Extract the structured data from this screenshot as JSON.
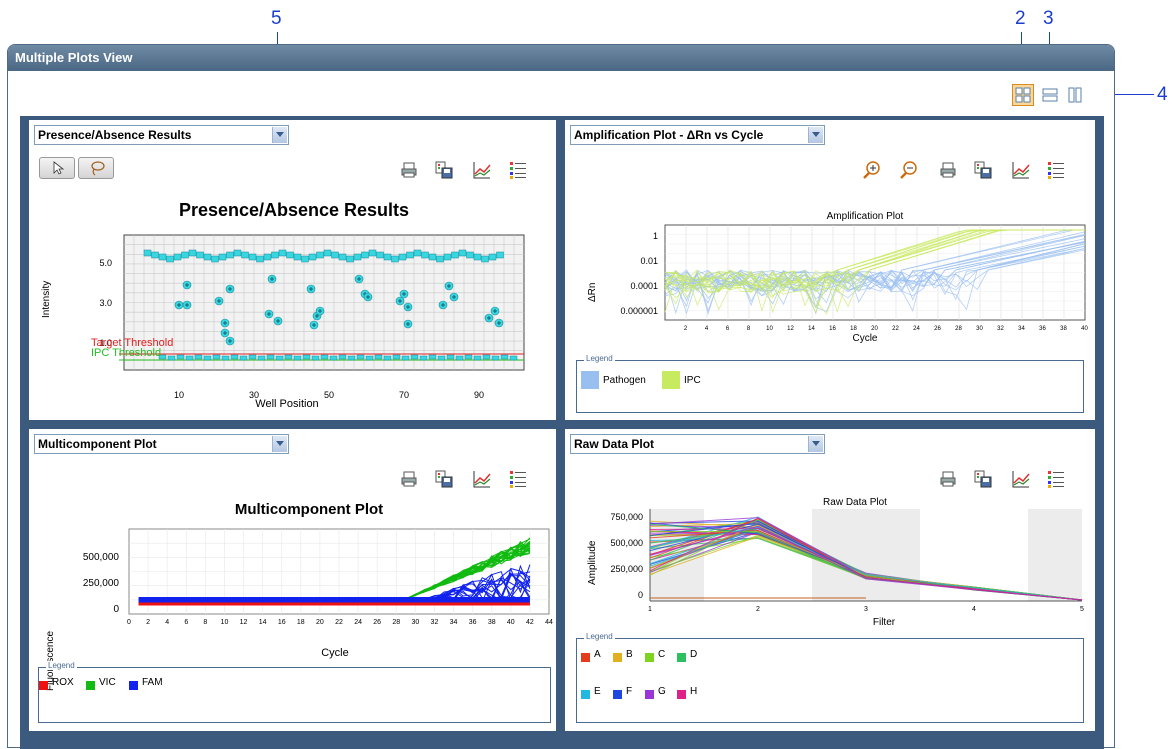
{
  "callouts": {
    "c5": "5",
    "c2": "2",
    "c3": "3",
    "c4": "4"
  },
  "window": {
    "title": "Multiple Plots View"
  },
  "layout_buttons": [
    "grid-2x2",
    "rows",
    "columns"
  ],
  "panels": {
    "pa": {
      "dropdown": "Presence/Absence Results",
      "tools": [
        "select-arrow-icon",
        "lasso-icon",
        "print-icon",
        "save-image-icon",
        "graph-properties-icon",
        "legend-icon"
      ],
      "chart_title": "Presence/Absence Results",
      "ylabel": "Intensity",
      "xlabel": "Well Position",
      "yticks": [
        "5.0",
        "3.0",
        "1.0"
      ],
      "xticks": [
        "10",
        "30",
        "50",
        "70",
        "90"
      ],
      "target_threshold": "Target Threshold",
      "ipc_threshold": "IPC Threshold",
      "colors": {
        "points": "#38d6e0",
        "target": "#e02020",
        "ipc": "#20c020"
      }
    },
    "amp": {
      "dropdown": "Amplification Plot - ΔRn vs Cycle",
      "tools": [
        "zoom-in-icon",
        "zoom-out-icon",
        "print-icon",
        "save-image-icon",
        "graph-properties-icon",
        "legend-icon"
      ],
      "chart_title": "Amplification Plot",
      "ylabel": "ΔRn",
      "xlabel": "Cycle",
      "yticks": [
        "1",
        "0.01",
        "0.0001",
        "0.000001"
      ],
      "xticks": [
        "2",
        "4",
        "6",
        "8",
        "10",
        "12",
        "14",
        "16",
        "18",
        "20",
        "22",
        "24",
        "26",
        "28",
        "30",
        "32",
        "34",
        "36",
        "38",
        "40"
      ],
      "legend_title": "Legend",
      "legend": [
        {
          "label": "Pathogen",
          "color": "#99bff0"
        },
        {
          "label": "IPC",
          "color": "#c8ea60"
        }
      ]
    },
    "mc": {
      "dropdown": "Multicomponent Plot",
      "tools": [
        "print-icon",
        "save-image-icon",
        "graph-properties-icon",
        "legend-icon"
      ],
      "chart_title": "Multicomponent Plot",
      "ylabel": "Fluorescence",
      "xlabel": "Cycle",
      "yticks": [
        "500,000",
        "250,000",
        "0"
      ],
      "xticks": [
        "0",
        "2",
        "4",
        "6",
        "8",
        "10",
        "12",
        "14",
        "16",
        "18",
        "20",
        "22",
        "24",
        "26",
        "28",
        "30",
        "32",
        "34",
        "36",
        "38",
        "40",
        "42",
        "44"
      ],
      "legend_title": "Legend",
      "legend": [
        {
          "label": "ROX",
          "color": "#ee1111"
        },
        {
          "label": "VIC",
          "color": "#11bb11"
        },
        {
          "label": "FAM",
          "color": "#1122ee"
        }
      ]
    },
    "raw": {
      "dropdown": "Raw Data Plot",
      "tools": [
        "print-icon",
        "save-image-icon",
        "graph-properties-icon",
        "legend-icon"
      ],
      "chart_title": "Raw Data Plot",
      "ylabel": "Amplitude",
      "xlabel": "Filter",
      "yticks": [
        "750,000",
        "500,000",
        "250,000",
        "0"
      ],
      "xticks": [
        "1",
        "2",
        "3",
        "4",
        "5"
      ],
      "legend_title": "Legend",
      "legend": [
        {
          "label": "A",
          "color": "#e43c1c"
        },
        {
          "label": "B",
          "color": "#e0b020"
        },
        {
          "label": "C",
          "color": "#7ed321"
        },
        {
          "label": "D",
          "color": "#2ec060"
        },
        {
          "label": "E",
          "color": "#22b8e0"
        },
        {
          "label": "F",
          "color": "#2046e0"
        },
        {
          "label": "G",
          "color": "#9a36d8"
        },
        {
          "label": "H",
          "color": "#e0208a"
        }
      ]
    }
  }
}
